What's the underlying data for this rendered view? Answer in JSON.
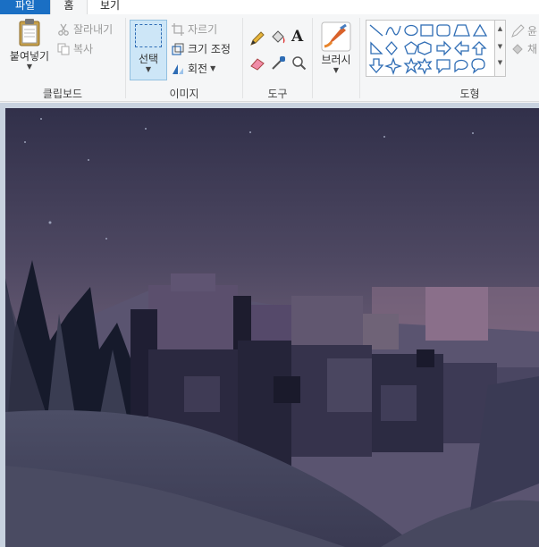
{
  "tabs": {
    "file": "파일",
    "home": "홈",
    "view": "보기"
  },
  "clipboard": {
    "paste": "붙여넣기",
    "cut": "잘라내기",
    "copy": "복사",
    "label": "클립보드"
  },
  "image": {
    "select": "선택",
    "crop": "자르기",
    "resize": "크기 조정",
    "rotate": "회전",
    "label": "이미지"
  },
  "tools": {
    "label": "도구"
  },
  "brushes": {
    "label": "브러시"
  },
  "shapes": {
    "label": "도형",
    "outline_partial": "윤",
    "fill_partial": "채"
  },
  "colors": {
    "accent": "#1a6fc4",
    "selected_bg": "#cde6f7"
  }
}
